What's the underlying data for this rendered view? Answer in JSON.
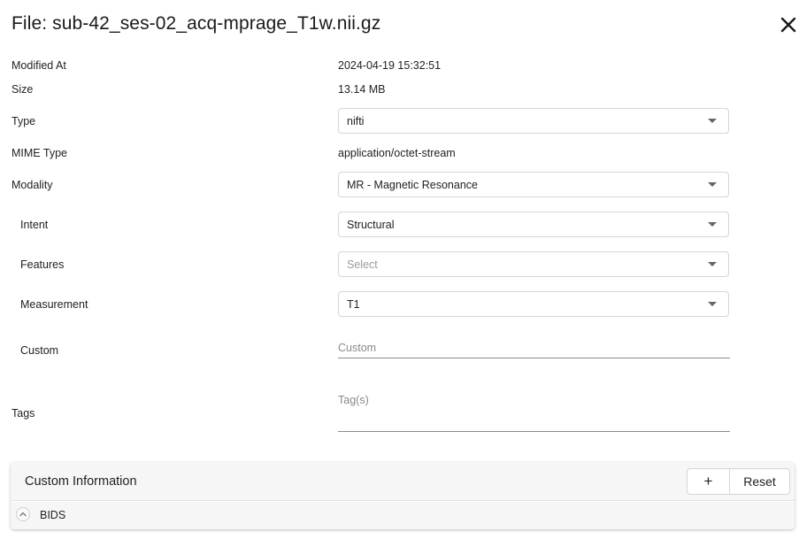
{
  "dialog": {
    "title": "File: sub-42_ses-02_acq-mprage_T1w.nii.gz"
  },
  "fields": {
    "modified_at": {
      "label": "Modified At",
      "value": "2024-04-19 15:32:51"
    },
    "size": {
      "label": "Size",
      "value": "13.14 MB"
    },
    "type": {
      "label": "Type",
      "value": "nifti"
    },
    "mime_type": {
      "label": "MIME Type",
      "value": "application/octet-stream"
    },
    "modality": {
      "label": "Modality",
      "value": "MR - Magnetic Resonance"
    },
    "intent": {
      "label": "Intent",
      "value": "Structural"
    },
    "features": {
      "label": "Features",
      "placeholder": "Select"
    },
    "measurement": {
      "label": "Measurement",
      "value": "T1"
    },
    "custom": {
      "label": "Custom",
      "placeholder": "Custom"
    },
    "tags": {
      "label": "Tags",
      "placeholder": "Tag(s)"
    }
  },
  "custom_info": {
    "title": "Custom Information",
    "add_label": "+",
    "reset_label": "Reset",
    "sections": [
      {
        "label": "BIDS",
        "expanded": true
      }
    ]
  },
  "icons": {
    "close": "close-icon",
    "collapse": "chevron-up-icon",
    "dropdown": "caret-down-icon"
  }
}
